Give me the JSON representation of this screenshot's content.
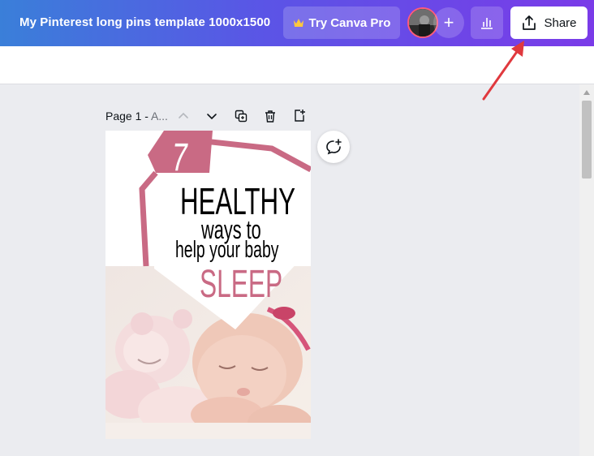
{
  "header": {
    "title": "My Pinterest long pins template 1000x1500",
    "try_pro_label": "Try Canva Pro",
    "add_label": "+",
    "share_label": "Share"
  },
  "page_bar": {
    "label": "Page 1 -",
    "subtitle": "A..."
  },
  "design": {
    "number": "7",
    "line1": "HEALTHY",
    "line2": "ways to",
    "line3": "help your baby",
    "line4": "SLEEP"
  },
  "colors": {
    "accent_pink": "#c96a84",
    "header_start": "#3a7fd9",
    "header_end": "#7a3be8",
    "annotation_arrow": "#e0393e"
  },
  "icons": {
    "crown": "crown-icon",
    "insights": "bar-chart-icon",
    "share": "upload-icon",
    "chevron_up": "chevron-up-icon",
    "chevron_down": "chevron-down-icon",
    "duplicate": "duplicate-icon",
    "delete": "trash-icon",
    "add_page": "add-page-icon",
    "comment": "comment-add-icon"
  }
}
